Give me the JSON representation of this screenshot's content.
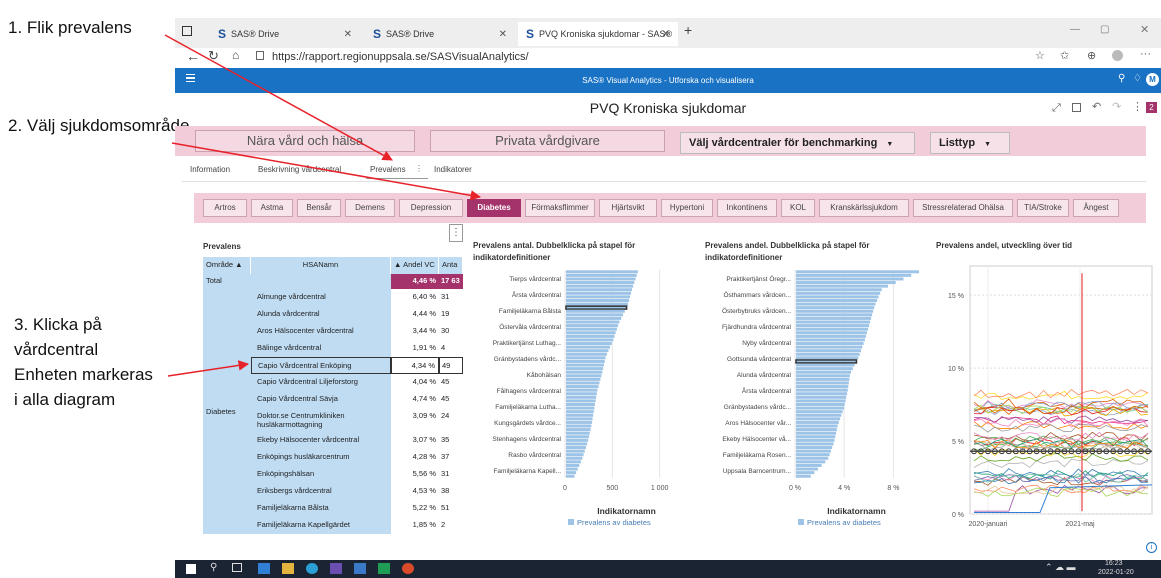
{
  "callouts": {
    "c1": "1. Flik prevalens",
    "c2": "2. Välj sjukdomsområde",
    "c3": [
      "3. Klicka på",
      "vårdcentral",
      "Enheten markeras",
      "i alla diagram"
    ]
  },
  "browser": {
    "tabs": [
      {
        "label": "SAS® Drive",
        "active": false
      },
      {
        "label": "SAS® Drive",
        "active": false
      },
      {
        "label": "PVQ Kroniska sjukdomar - SAS®",
        "active": true
      }
    ],
    "url": "https://rapport.regionuppsala.se/SASVisualAnalytics/"
  },
  "app": {
    "title": "SAS® Visual Analytics - Utforska och visualisera",
    "report_title": "PVQ Kroniska sjukdomar",
    "badge": "2"
  },
  "nav": {
    "near": "Nära vård och hälsa",
    "private": "Privata vårdgivare",
    "benchmark": "Välj vårdcentraler för benchmarking",
    "listtyp": "Listtyp"
  },
  "subtabs": [
    "Information",
    "Beskrivning vårdcentral",
    "Prevalens",
    "Indikatorer"
  ],
  "disease_tabs": [
    "Artros",
    "Astma",
    "Bensår",
    "Demens",
    "Depression",
    "Diabetes",
    "Förmaksflimmer",
    "Hjärtsvikt",
    "Hypertoni",
    "Inkontinens",
    "KOL",
    "Kranskärlssjukdom",
    "Stressrelaterad Ohälsa",
    "TIA/Stroke",
    "Ångest"
  ],
  "table": {
    "title": "Prevalens",
    "headers": [
      "Område ▲",
      "HSANamn",
      "▲ Andel VC",
      "Anta"
    ],
    "total_label": "Total",
    "total_andel": "4,46 %",
    "total_antal": "17 63",
    "area": "Diabetes",
    "rows": [
      {
        "name": "Almunge vårdcentral",
        "andel": "6,40 %",
        "antal": "31"
      },
      {
        "name": "Alunda vårdcentral",
        "andel": "4,44 %",
        "antal": "19"
      },
      {
        "name": "Aros Hälsocenter vårdcentral",
        "andel": "3,44 %",
        "antal": "30"
      },
      {
        "name": "Bälinge vårdcentral",
        "andel": "1,91 %",
        "antal": "4"
      },
      {
        "name": "Capio Vårdcentral Enköping",
        "andel": "4,34 %",
        "antal": "49"
      },
      {
        "name": "Capio Vårdcentral Liljeforstorg",
        "andel": "4,04 %",
        "antal": "45"
      },
      {
        "name": "Capio Vårdcentral Sävja",
        "andel": "4,74 %",
        "antal": "45"
      },
      {
        "name": "Doktor.se Centrumkliniken husläkarmottagning",
        "andel": "3,09 %",
        "antal": "24"
      },
      {
        "name": "Ekeby Hälsocenter vårdcentral",
        "andel": "3,07 %",
        "antal": "35"
      },
      {
        "name": "Enköpings husläkarcentrum",
        "andel": "4,28 %",
        "antal": "37"
      },
      {
        "name": "Enköpingshälsan",
        "andel": "5,56 %",
        "antal": "31"
      },
      {
        "name": "Eriksbergs vårdcentral",
        "andel": "4,53 %",
        "antal": "38"
      },
      {
        "name": "Familjeläkarna Bålsta",
        "andel": "5,22 %",
        "antal": "51"
      },
      {
        "name": "Familjeläkarna Kapellgärdet",
        "andel": "1,85 %",
        "antal": "2"
      }
    ]
  },
  "chart_data": [
    {
      "type": "bar",
      "title": "Prevalens antal. Dubbelklicka på stapel för indikatordefinitioner",
      "categories": [
        "Tierps vårdcentral",
        "Årsta vårdcentral",
        "Familjeläkarna Bålsta",
        "Östervåla vårdcentral",
        "Praktikertjänst Luthag...",
        "Gränbystadens vårdc...",
        "Kåbohälsan",
        "Fålhagens vårdcentral",
        "Familjeläkarna Lutha...",
        "Kungsgärdets vårdce...",
        "Stenhagens vårdcentral",
        "Rasbo vårdcentral",
        "Familjeläkarna Kapell..."
      ],
      "x_ticks": [
        "0",
        "500",
        "1 000"
      ],
      "xlim": [
        0,
        1300
      ],
      "xlabel": "Indikatornamn",
      "legend": "Prevalens av diabetes",
      "values": [
        760,
        700,
        650,
        560,
        500,
        420,
        380,
        330,
        300,
        270,
        230,
        170,
        90
      ]
    },
    {
      "type": "bar",
      "title": "Prevalens andel. Dubbelklicka på stapel för indikatordefinitioner",
      "categories": [
        "Praktikertjänst Öregr...",
        "Östhammars vårdcen...",
        "Österbybruks vårdcen...",
        "Fjärdhundra vårdcentral",
        "Nyby vårdcentral",
        "Gottsunda vårdcentral",
        "Alunda vårdcentral",
        "Årsta vårdcentral",
        "Gränbystadens vårdc...",
        "Aros Hälsocenter vår...",
        "Ekeby Hälsocenter vå...",
        "Familjeläkarna Rosen...",
        "Uppsala Barncentrum..."
      ],
      "x_ticks": [
        "0 %",
        "4 %",
        "8 %"
      ],
      "xlim": [
        0,
        10
      ],
      "xlabel": "Indikatornamn",
      "legend": "Prevalens av diabetes",
      "values": [
        10.0,
        7.0,
        6.4,
        6.0,
        5.6,
        5.1,
        4.4,
        4.2,
        3.9,
        3.4,
        3.1,
        2.6,
        1.2
      ]
    },
    {
      "type": "line",
      "title": "Prevalens andel, utveckling över tid",
      "y_ticks": [
        "0 %",
        "5 %",
        "10 %",
        "15 %"
      ],
      "ylim": [
        0,
        17
      ],
      "x_ticks": [
        "2020-januari",
        "2021-maj"
      ]
    }
  ],
  "taskbar": {
    "time": "16:23",
    "date": "2022-01-20"
  },
  "colors": {
    "sas_blue": "#1a72c4",
    "pink_band": "#f2ccd8",
    "selected_tab": "#a4336b",
    "bar": "#9dc3e6",
    "table_blue": "#bfdcf3",
    "arrow": "#e8222a"
  }
}
